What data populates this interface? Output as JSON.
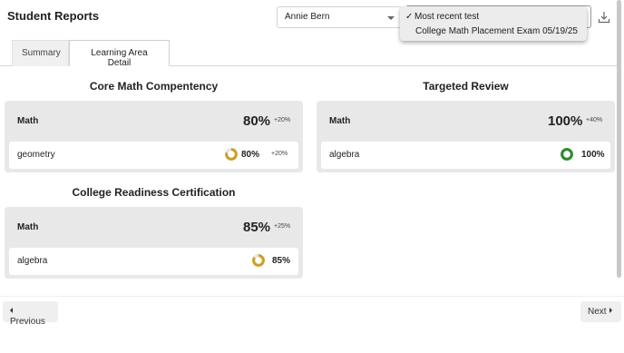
{
  "header": {
    "title": "Student Reports",
    "student_select": "Annie Bern",
    "test_menu": {
      "selected": "Most recent test",
      "option": "College Math Placement Exam 05/19/25"
    }
  },
  "tabs": [
    {
      "label": "Summary",
      "active": false
    },
    {
      "label": "Learning Area Detail",
      "active": true
    }
  ],
  "sections": {
    "core": {
      "title": "Core Math Compentency",
      "subject": "Math",
      "percent": "80%",
      "delta": "+20%",
      "rows": [
        {
          "label": "geometry",
          "percent": "80%",
          "value": 80,
          "delta": "+20%",
          "ring_color": "#c9a227"
        }
      ]
    },
    "targeted": {
      "title": "Targeted Review",
      "subject": "Math",
      "percent": "100%",
      "delta": "+40%",
      "rows": [
        {
          "label": "algebra",
          "percent": "100%",
          "value": 100,
          "delta": "",
          "ring_color": "#2e8b2e"
        }
      ]
    },
    "readiness": {
      "title": "College Readiness Certification",
      "subject": "Math",
      "percent": "85%",
      "delta": "+25%",
      "rows": [
        {
          "label": "algebra",
          "percent": "85%",
          "value": 85,
          "delta": "",
          "ring_color": "#c9a227"
        }
      ]
    }
  },
  "footer": {
    "previous": "Previous",
    "next": "Next"
  }
}
